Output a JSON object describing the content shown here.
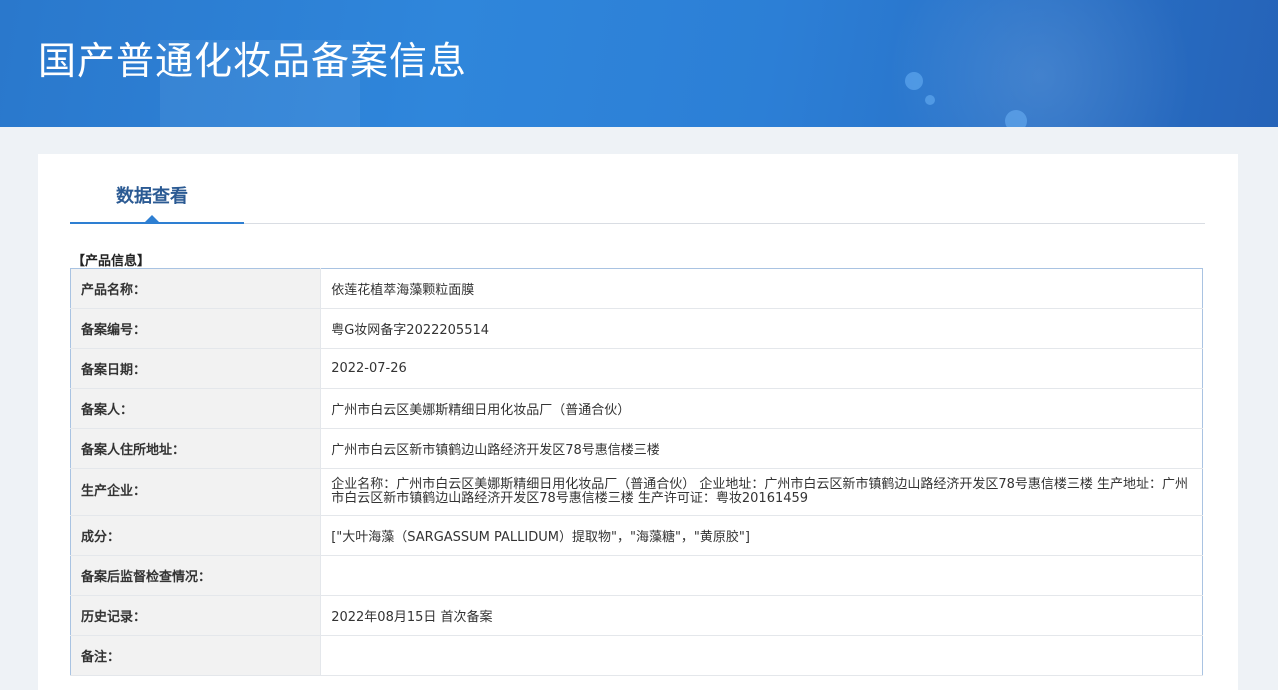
{
  "header": {
    "title": "国产普通化妆品备案信息"
  },
  "tabs": [
    {
      "label": "数据查看",
      "active": true
    }
  ],
  "section": {
    "title": "【产品信息】"
  },
  "rows": [
    {
      "label": "产品名称：",
      "value": "依莲花植萃海藻颗粒面膜"
    },
    {
      "label": "备案编号：",
      "value": "粤G妆网备字2022205514"
    },
    {
      "label": "备案日期：",
      "value": "2022-07-26"
    },
    {
      "label": "备案人：",
      "value": "广州市白云区美娜斯精细日用化妆品厂（普通合伙）"
    },
    {
      "label": "备案人住所地址：",
      "value": "广州市白云区新市镇鹤边山路经济开发区78号惠信楼三楼"
    },
    {
      "label": "生产企业：",
      "value": "企业名称：广州市白云区美娜斯精细日用化妆品厂（普通合伙） 企业地址：广州市白云区新市镇鹤边山路经济开发区78号惠信楼三楼 生产地址：广州市白云区新市镇鹤边山路经济开发区78号惠信楼三楼 生产许可证：粤妆20161459"
    },
    {
      "label": "成分：",
      "value": "[\"大叶海藻（SARGASSUM PALLIDUM）提取物\"，\"海藻糖\"，\"黄原胶\"]"
    },
    {
      "label": "备案后监督检查情况：",
      "value": ""
    },
    {
      "label": "历史记录：",
      "value": "2022年08月15日 首次备案"
    },
    {
      "label": "备注：",
      "value": ""
    }
  ],
  "colors": {
    "banner": "#2f86db",
    "tab_accent": "#2e7fd2",
    "tab_text": "#2b5a93",
    "table_border": "#a9c3e2",
    "label_bg": "#f2f2f2"
  }
}
